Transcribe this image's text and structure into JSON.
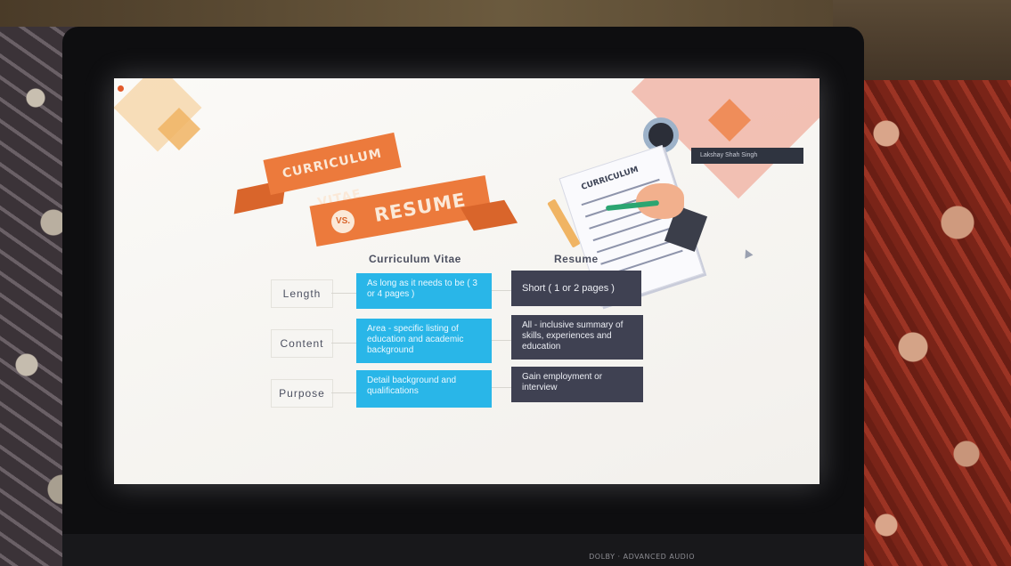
{
  "slide": {
    "banner_cv": "CURRICULUM VITAE",
    "banner_vs": "VS.",
    "banner_resume": "RESUME",
    "name_tag": "Lakshay Shah Singh",
    "illustration_label": "CURRICULUM",
    "columns": {
      "cv": "Curriculum Vitae",
      "resume": "Resume"
    },
    "rows": [
      {
        "label": "Length",
        "cv": "As long as it needs to be ( 3 or 4 pages )",
        "resume": "Short ( 1 or 2 pages )"
      },
      {
        "label": "Content",
        "cv": "Area - specific listing of education and academic background",
        "resume": "All - inclusive summary of skills, experiences and education"
      },
      {
        "label": "Purpose",
        "cv": "Detail background and qualifications",
        "resume": "Gain employment or interview"
      }
    ]
  },
  "laptop": {
    "badge": "DOLBY · ADVANCED AUDIO"
  },
  "colors": {
    "cv_cell": "#29b6e8",
    "resume_cell": "#3f4152",
    "banner": "#ec7a3c"
  }
}
